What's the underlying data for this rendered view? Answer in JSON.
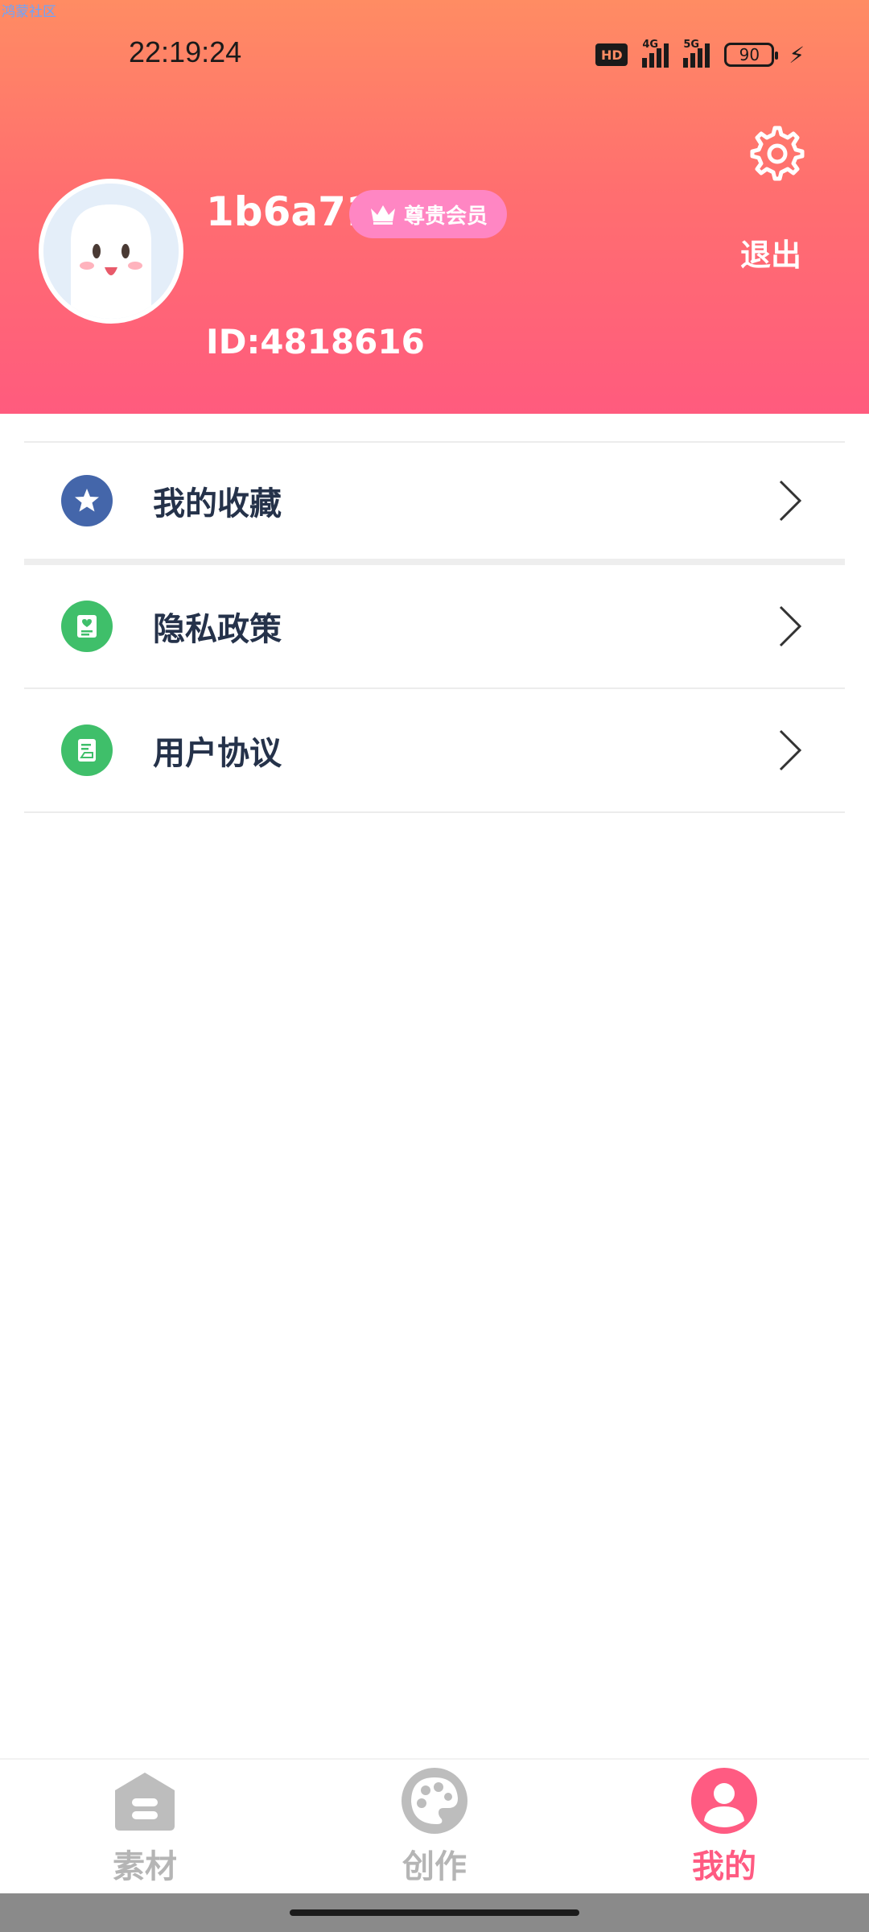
{
  "watermark": "鸿蒙社区",
  "status_bar": {
    "time": "22:19:24",
    "hd_label": "HD",
    "network_1": "4G",
    "network_2": "5G",
    "battery_level": "90"
  },
  "profile": {
    "username": "1b6a71",
    "vip_label": "尊贵会员",
    "user_id": "ID:4818616",
    "logout_label": "退出"
  },
  "menu": {
    "items": [
      {
        "label": "我的收藏",
        "icon": "star-icon",
        "color": "#4466aa"
      },
      {
        "label": "隐私政策",
        "icon": "privacy-doc-icon",
        "color": "#3fbf6a"
      },
      {
        "label": "用户协议",
        "icon": "agreement-doc-icon",
        "color": "#3fbf6a"
      }
    ]
  },
  "bottom_nav": {
    "items": [
      {
        "label": "素材",
        "icon": "material-icon",
        "active": false
      },
      {
        "label": "创作",
        "icon": "palette-icon",
        "active": false
      },
      {
        "label": "我的",
        "icon": "profile-icon",
        "active": true
      }
    ]
  },
  "colors": {
    "header_top": "#ff8c63",
    "header_bottom": "#ff5b7e",
    "active_tab": "#ff5b82",
    "inactive_tab": "#b5b5b5",
    "vip_badge": "#ff86c3"
  }
}
